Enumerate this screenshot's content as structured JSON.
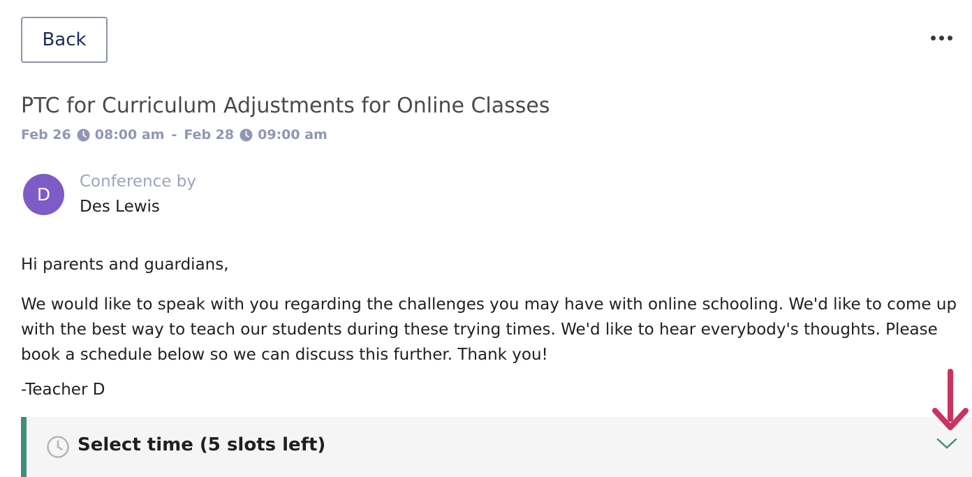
{
  "header": {
    "back_label": "Back",
    "more_icon": "more-horizontal-icon"
  },
  "conference": {
    "title": "PTC for Curriculum Adjustments for Online Classes",
    "start_date": "Feb 26",
    "start_time": "08:00 am",
    "separator": "-",
    "end_date": "Feb 28",
    "end_time": "09:00 am",
    "organizer_caption": "Conference by",
    "organizer_name": "Des Lewis",
    "organizer_initial": "D"
  },
  "message": {
    "greeting": "Hi parents and guardians,",
    "body": "We would like to speak with you regarding the challenges you may have with online schooling. We'd like to come up with the best way to teach our students during these trying times. We'd like to hear everybody's thoughts. Please book a schedule below so we can discuss this further. Thank you!",
    "signature": "-Teacher D"
  },
  "slots": {
    "label": "Select time (5 slots left)"
  },
  "colors": {
    "accent_green": "#3f8f79",
    "avatar_purple": "#7e5bc6",
    "annotation_arrow": "#c8335f",
    "muted_text": "#8f97b3"
  }
}
